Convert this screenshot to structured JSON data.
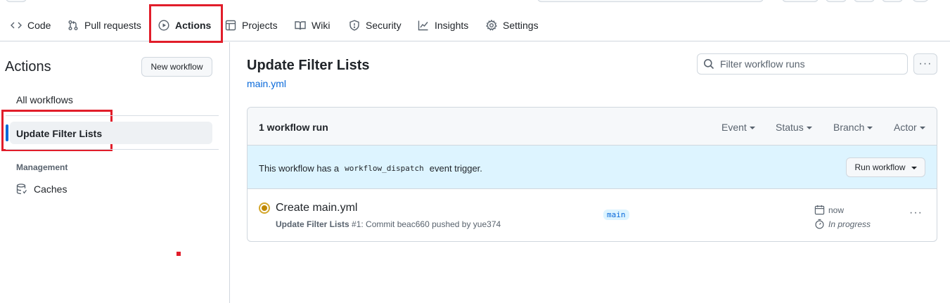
{
  "nav": {
    "items": [
      {
        "label": "Code",
        "icon": "code-icon"
      },
      {
        "label": "Pull requests",
        "icon": "git-pull-request-icon"
      },
      {
        "label": "Actions",
        "icon": "play-icon"
      },
      {
        "label": "Projects",
        "icon": "table-icon"
      },
      {
        "label": "Wiki",
        "icon": "book-icon"
      },
      {
        "label": "Security",
        "icon": "shield-icon"
      },
      {
        "label": "Insights",
        "icon": "graph-icon"
      },
      {
        "label": "Settings",
        "icon": "gear-icon"
      }
    ]
  },
  "sidebar": {
    "title": "Actions",
    "new_workflow_label": "New workflow",
    "all_workflows_label": "All workflows",
    "active_workflow_label": "Update Filter Lists",
    "management_label": "Management",
    "caches_label": "Caches"
  },
  "main": {
    "title": "Update Filter Lists",
    "file_link": "main.yml",
    "filter_placeholder": "Filter workflow runs",
    "more_label": "···",
    "runs_count": "1 workflow run",
    "filters": [
      "Event",
      "Status",
      "Branch",
      "Actor"
    ],
    "dispatch": {
      "before": "This workflow has a",
      "code": "workflow_dispatch",
      "after": "event trigger.",
      "run_button": "Run workflow"
    },
    "run": {
      "title": "Create main.yml",
      "workflow_name": "Update Filter Lists",
      "details": "#1: Commit beac660 pushed by yue374",
      "branch": "main",
      "time": "now",
      "status": "In progress",
      "more_label": "···"
    }
  },
  "colors": {
    "accent_blue": "#0969da",
    "highlight_red": "#e11d2a",
    "in_progress": "#bf8700",
    "info_bg": "#ddf4ff"
  }
}
